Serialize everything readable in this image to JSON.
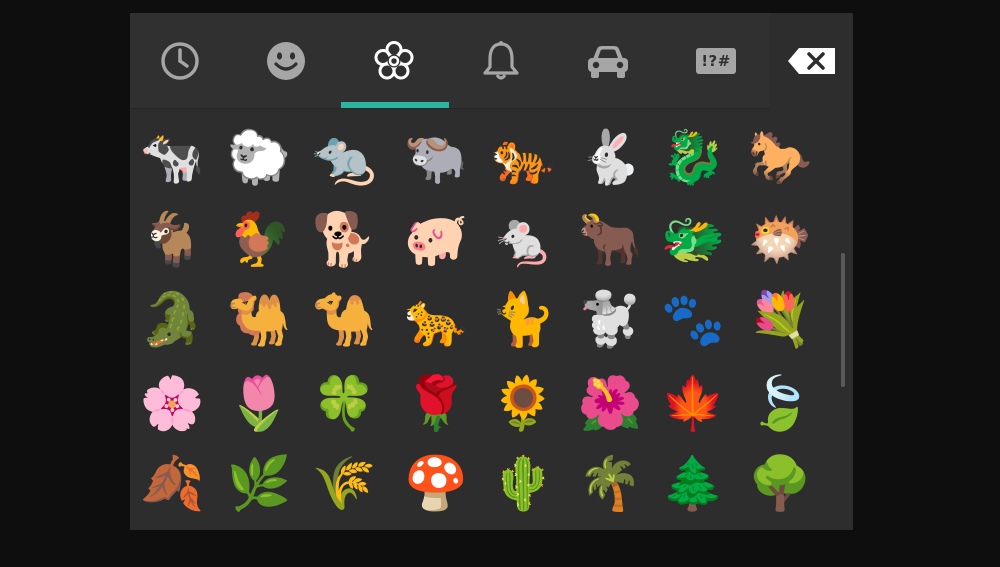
{
  "keyboard": {
    "tabs": [
      {
        "name": "recent",
        "icon": "clock-icon"
      },
      {
        "name": "smileys",
        "icon": "smiley-face-icon"
      },
      {
        "name": "nature",
        "icon": "flower-icon",
        "selected": true
      },
      {
        "name": "objects",
        "icon": "bell-icon"
      },
      {
        "name": "places",
        "icon": "car-icon"
      },
      {
        "name": "symbols",
        "icon": "symbols-icon",
        "label": "!?#"
      }
    ],
    "backspace_icon": "backspace-icon",
    "accent_color": "#2ab5a0",
    "emoji_rows": [
      [
        {
          "char": "🐄",
          "name": "cow"
        },
        {
          "char": "🐑",
          "name": "sheep"
        },
        {
          "char": "🐀",
          "name": "rat"
        },
        {
          "char": "🐃",
          "name": "water-buffalo"
        },
        {
          "char": "🐅",
          "name": "tiger"
        },
        {
          "char": "🐇",
          "name": "rabbit"
        },
        {
          "char": "🐉",
          "name": "dragon"
        },
        {
          "char": "🐎",
          "name": "horse"
        }
      ],
      [
        {
          "char": "🐐",
          "name": "goat"
        },
        {
          "char": "🐓",
          "name": "rooster"
        },
        {
          "char": "🐕",
          "name": "dog"
        },
        {
          "char": "🐖",
          "name": "pig"
        },
        {
          "char": "🐁",
          "name": "mouse"
        },
        {
          "char": "🐂",
          "name": "ox"
        },
        {
          "char": "🐲",
          "name": "dragon-face"
        },
        {
          "char": "🐡",
          "name": "blowfish"
        }
      ],
      [
        {
          "char": "🐊",
          "name": "crocodile"
        },
        {
          "char": "🐫",
          "name": "two-hump-camel"
        },
        {
          "char": "🐪",
          "name": "camel"
        },
        {
          "char": "🐆",
          "name": "leopard"
        },
        {
          "char": "🐈",
          "name": "cat"
        },
        {
          "char": "🐩",
          "name": "poodle"
        },
        {
          "char": "🐾",
          "name": "paw-prints"
        },
        {
          "char": "💐",
          "name": "bouquet"
        }
      ],
      [
        {
          "char": "🌸",
          "name": "cherry-blossom"
        },
        {
          "char": "🌷",
          "name": "tulip"
        },
        {
          "char": "🍀",
          "name": "four-leaf-clover"
        },
        {
          "char": "🌹",
          "name": "rose"
        },
        {
          "char": "🌻",
          "name": "sunflower"
        },
        {
          "char": "🌺",
          "name": "hibiscus"
        },
        {
          "char": "🍁",
          "name": "maple-leaf"
        },
        {
          "char": "🍃",
          "name": "leaf-fluttering"
        }
      ],
      [
        {
          "char": "🍂",
          "name": "fallen-leaf"
        },
        {
          "char": "🌿",
          "name": "herb"
        },
        {
          "char": "🌾",
          "name": "sheaf-of-rice"
        },
        {
          "char": "🍄",
          "name": "mushroom"
        },
        {
          "char": "🌵",
          "name": "cactus"
        },
        {
          "char": "🌴",
          "name": "palm-tree"
        },
        {
          "char": "🌲",
          "name": "evergreen-tree"
        },
        {
          "char": "🌳",
          "name": "deciduous-tree"
        }
      ]
    ]
  }
}
